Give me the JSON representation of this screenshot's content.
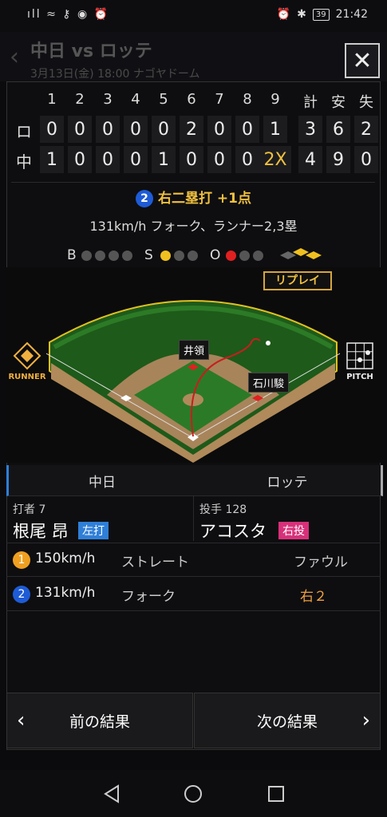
{
  "status_bar": {
    "left_icons": "ıll ≈ ⚷ ◉ ⏰",
    "battery": "39",
    "time": "21:42"
  },
  "background_header": {
    "title": "中日 vs ロッテ",
    "subtitle": "3月13日(金) 18:00 ナゴヤドーム"
  },
  "scoreboard": {
    "innings": [
      "1",
      "2",
      "3",
      "4",
      "5",
      "6",
      "7",
      "8",
      "9"
    ],
    "totals_headers": [
      "計",
      "安",
      "失"
    ],
    "rows": [
      {
        "team": "ロ",
        "scores": [
          "0",
          "0",
          "0",
          "0",
          "0",
          "2",
          "0",
          "0",
          "1"
        ],
        "totals": [
          "3",
          "6",
          "2"
        ]
      },
      {
        "team": "中",
        "scores": [
          "1",
          "0",
          "0",
          "0",
          "1",
          "0",
          "0",
          "0",
          "2X"
        ],
        "totals": [
          "4",
          "9",
          "0"
        ]
      }
    ]
  },
  "play": {
    "number": "2",
    "result": "右二塁打 +1点",
    "description": "131km/h フォーク、ランナー2,3塁"
  },
  "count": {
    "b_label": "B",
    "s_label": "S",
    "o_label": "O",
    "balls": 0,
    "strikes": 1,
    "outs": 1
  },
  "field": {
    "replay_label": "リプレイ",
    "runner_label": "RUNNER",
    "pitch_label": "PITCH",
    "fielder_labels": [
      "井領",
      "石川駿"
    ]
  },
  "teams": {
    "home": "中日",
    "away": "ロッテ"
  },
  "batter": {
    "role_label": "打者",
    "number": "7",
    "name": "根尾 昂",
    "hand": "左打"
  },
  "pitcher": {
    "role_label": "投手",
    "number": "128",
    "name": "アコスタ",
    "hand": "右投"
  },
  "pitches": [
    {
      "number": "1",
      "speed": "150km/h",
      "type": "ストレート",
      "result": "ファウル",
      "color": "#f0a020"
    },
    {
      "number": "2",
      "speed": "131km/h",
      "type": "フォーク",
      "result": "右２",
      "color": "#1e5bd6"
    }
  ],
  "nav": {
    "prev": "前の結果",
    "next": "次の結果"
  },
  "colors": {
    "accent": "#f0c040",
    "strike": "#f0c020",
    "out": "#e02020",
    "left_hand": "#2f7fd8",
    "right_hand": "#d8307a"
  }
}
